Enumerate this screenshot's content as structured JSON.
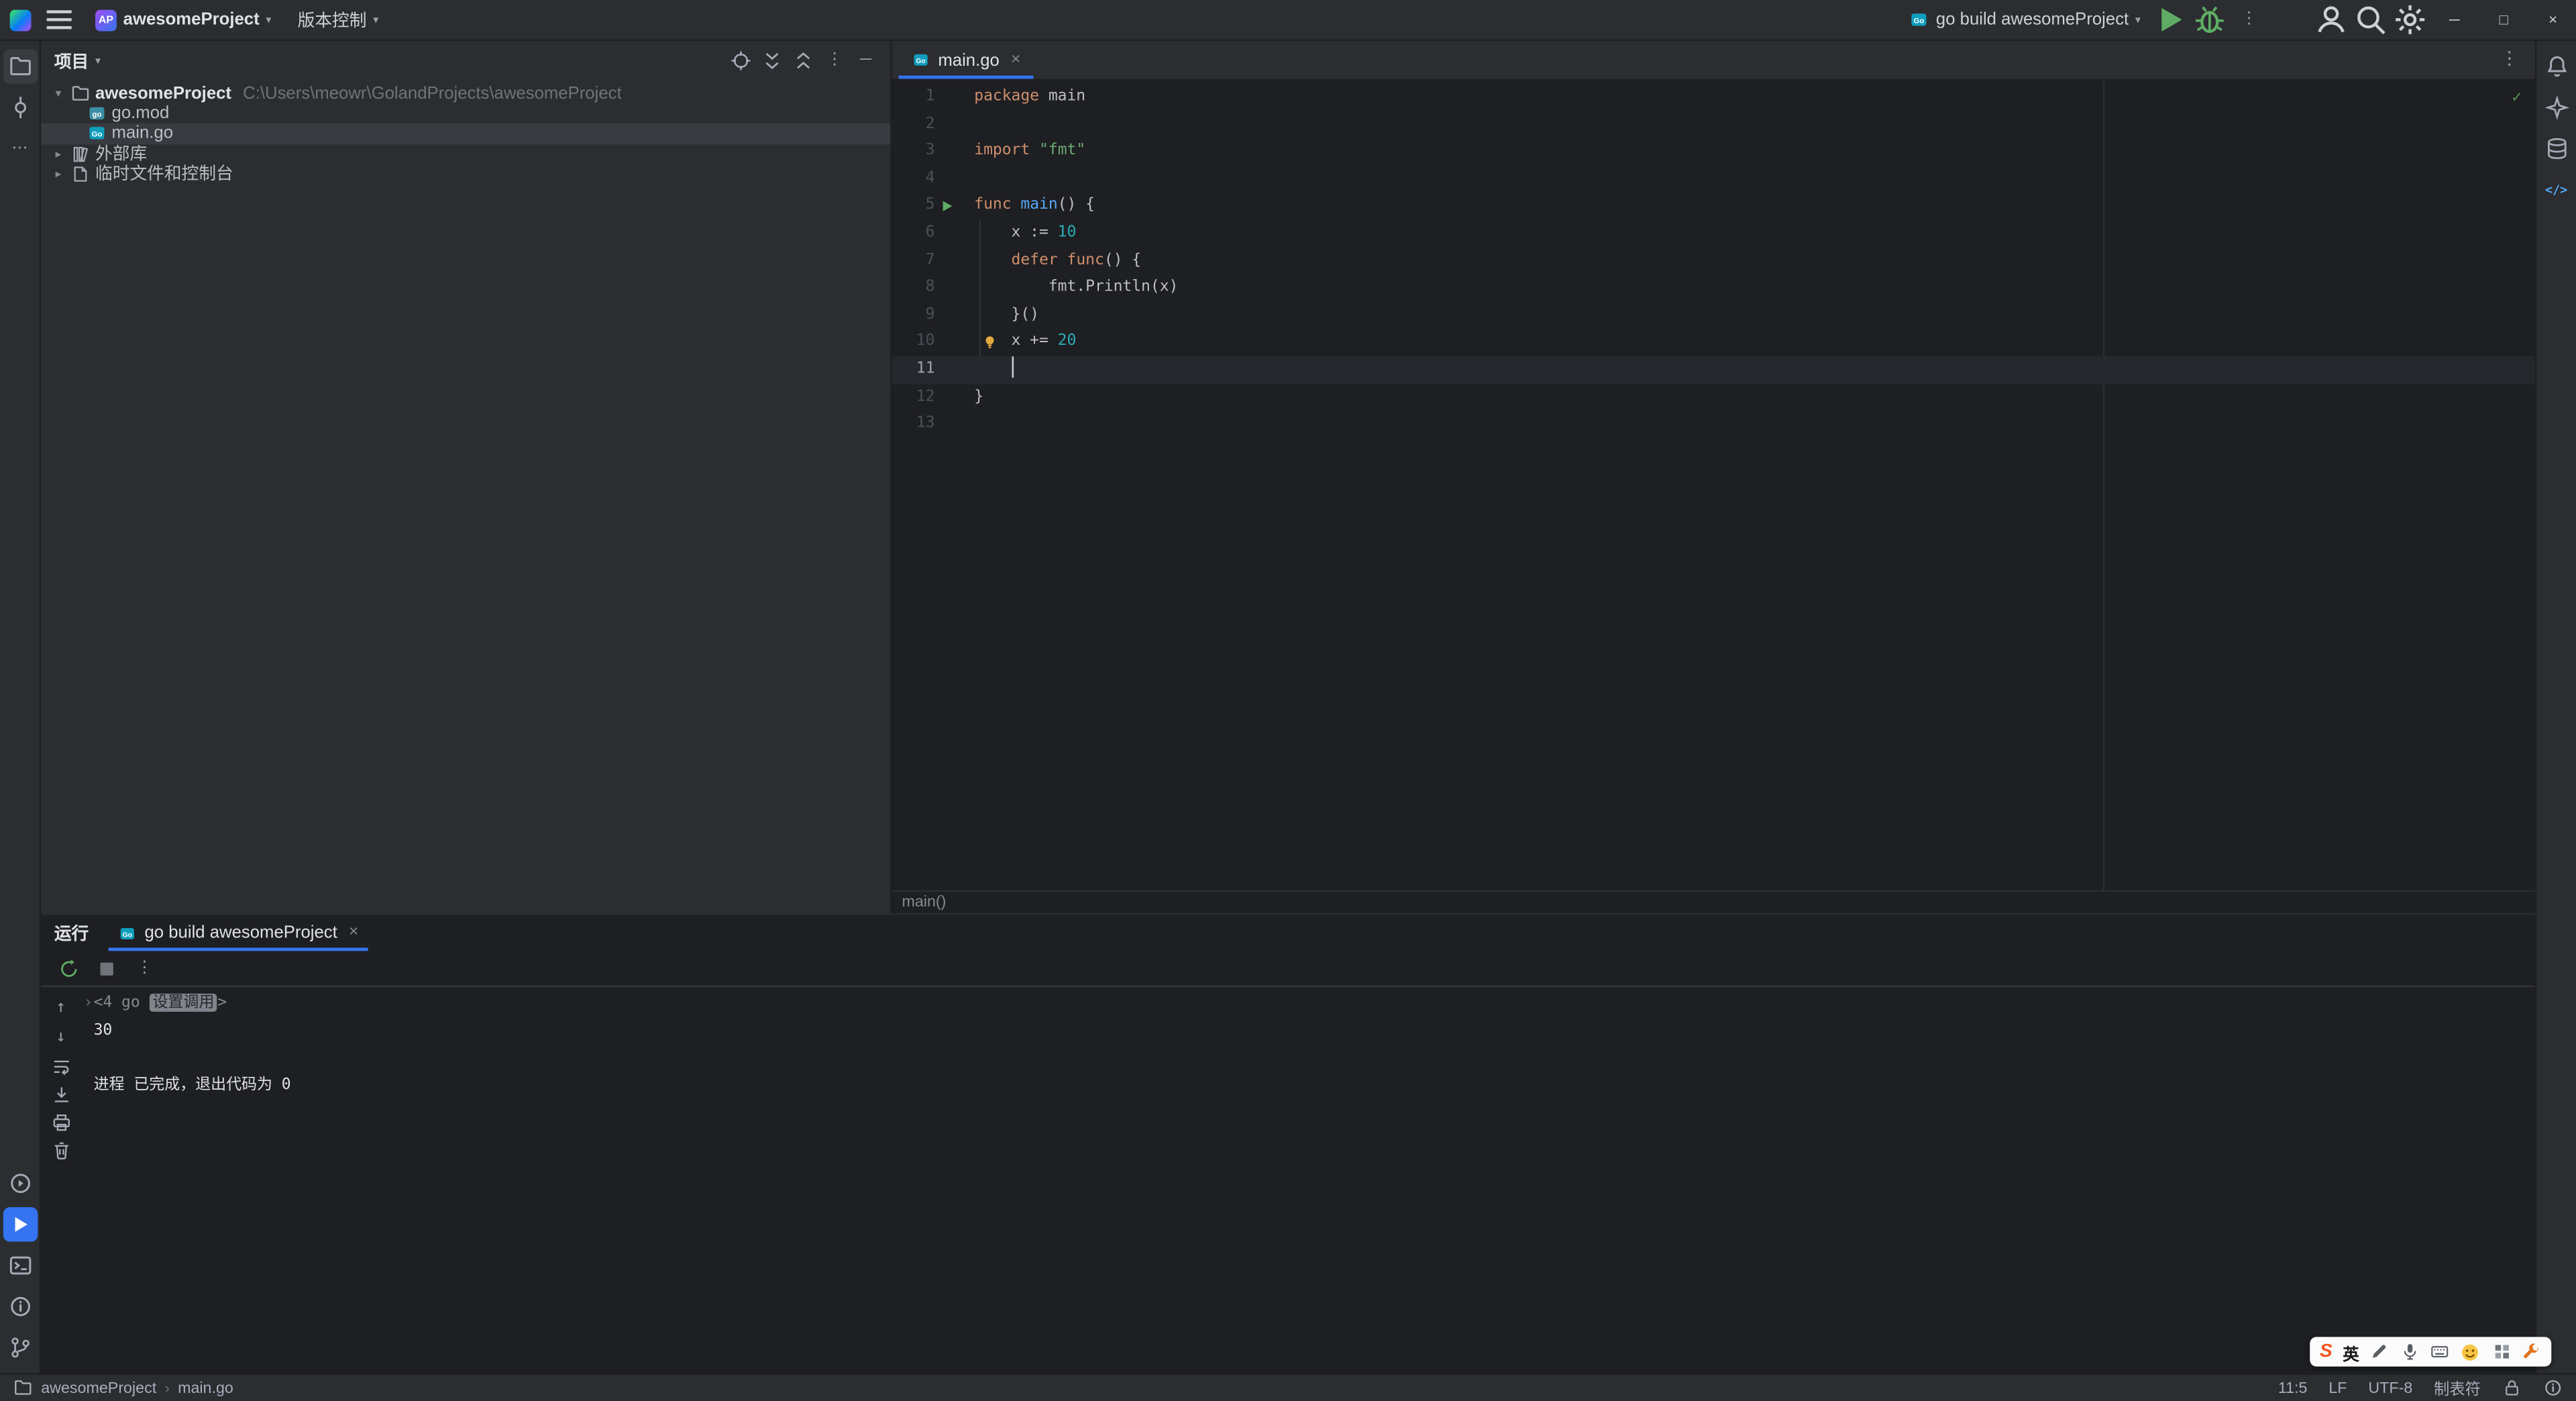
{
  "colors": {
    "accent": "#3574f0",
    "run_green": "#5fad65",
    "keyword": "#cf8e6d",
    "string": "#6aab73",
    "number": "#2aacb8",
    "function": "#56a8f5",
    "caret_line": "#26282e",
    "selection": "#393b40"
  },
  "icons": {
    "more_h": "⋯",
    "kebab": "⋮",
    "chevron_down": "▾",
    "chevron_right": "▸",
    "close": "×",
    "minimize": "─",
    "maximize": "□",
    "check": "✓",
    "up": "↑",
    "down": "↓",
    "crumb_sep": "›",
    "code_tag": "</>",
    "fold_arrow": "›"
  },
  "title_bar": {
    "project_badge": "AP",
    "project_name": "awesomeProject",
    "vcs_label": "版本控制",
    "run_config_name": "go build awesomeProject"
  },
  "project_panel": {
    "title": "项目",
    "items": [
      {
        "id": "root",
        "kind": "root",
        "label": "awesomeProject",
        "path": "C:\\Users\\meowr\\GolandProjects\\awesomeProject",
        "icon": "folder"
      },
      {
        "id": "go-mod",
        "kind": "file",
        "label": "go.mod",
        "icon": "gomod"
      },
      {
        "id": "main-go",
        "kind": "file",
        "label": "main.go",
        "icon": "gofile",
        "selected": true
      },
      {
        "id": "external-libraries",
        "kind": "node",
        "label": "外部库",
        "icon": "library"
      },
      {
        "id": "scratches-and-consoles",
        "kind": "node",
        "label": "临时文件和控制台",
        "icon": "scratch"
      }
    ]
  },
  "editor": {
    "tab_label": "main.go",
    "breadcrumb": "main()",
    "code": [
      {
        "n": "1",
        "segs": [
          [
            "kw",
            "package"
          ],
          [
            "fg",
            " main"
          ]
        ]
      },
      {
        "n": "2",
        "segs": []
      },
      {
        "n": "3",
        "segs": [
          [
            "kw",
            "import"
          ],
          [
            "fg",
            " "
          ],
          [
            "str",
            "\"fmt\""
          ]
        ]
      },
      {
        "n": "4",
        "segs": []
      },
      {
        "n": "5",
        "run": true,
        "segs": [
          [
            "kw",
            "func"
          ],
          [
            "fg",
            " "
          ],
          [
            "fn",
            "main"
          ],
          [
            "fg",
            "() {"
          ]
        ]
      },
      {
        "n": "6",
        "segs": [
          [
            "fg",
            "    x := "
          ],
          [
            "num",
            "10"
          ]
        ]
      },
      {
        "n": "7",
        "segs": [
          [
            "fg",
            "    "
          ],
          [
            "kw",
            "defer"
          ],
          [
            "fg",
            " "
          ],
          [
            "kw",
            "func"
          ],
          [
            "fg",
            "() {"
          ]
        ]
      },
      {
        "n": "8",
        "segs": [
          [
            "fg",
            "        fmt.Println(x)"
          ]
        ]
      },
      {
        "n": "9",
        "segs": [
          [
            "fg",
            "    }()"
          ]
        ]
      },
      {
        "n": "10",
        "bulb": true,
        "segs": [
          [
            "fg",
            "    x += "
          ],
          [
            "num",
            "20"
          ]
        ]
      },
      {
        "n": "11",
        "current": true,
        "caret": true,
        "segs": [
          [
            "fg",
            "    "
          ]
        ]
      },
      {
        "n": "12",
        "segs": [
          [
            "fg",
            "}"
          ]
        ]
      },
      {
        "n": "13",
        "segs": []
      }
    ]
  },
  "run_panel": {
    "title": "运行",
    "tab_label": "go build awesomeProject",
    "console": [
      {
        "kind": "fold",
        "pre": "<4 go ",
        "chip": "设置调用",
        "post": ">"
      },
      {
        "kind": "text",
        "text": "30"
      },
      {
        "kind": "text",
        "text": ""
      },
      {
        "kind": "text",
        "text": "进程 已完成，退出代码为 0"
      }
    ]
  },
  "status_bar": {
    "project": "awesomeProject",
    "file": "main.go",
    "cursor_position": "11:5",
    "line_separator": "LF",
    "encoding": "UTF-8",
    "indent_style": "制表符"
  },
  "ime_bar": {
    "logo": "S",
    "lang": "英"
  }
}
